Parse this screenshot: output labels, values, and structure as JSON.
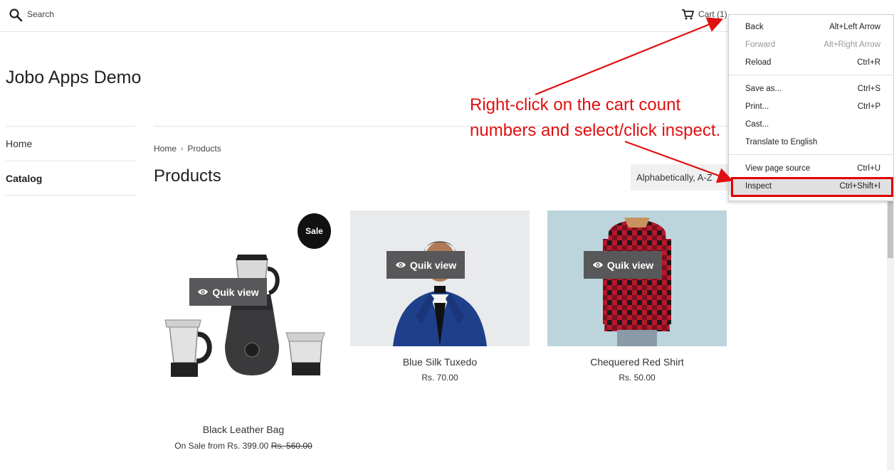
{
  "header": {
    "search_placeholder": "Search",
    "cart_label": "Cart (1)",
    "icons": {
      "search": "search-icon",
      "cart": "cart-icon"
    }
  },
  "site": {
    "title": "Jobo Apps Demo"
  },
  "sidebar": {
    "items": [
      {
        "label": "Home"
      },
      {
        "label": "Catalog"
      }
    ]
  },
  "breadcrumb": {
    "home": "Home",
    "separator": "›",
    "current": "Products"
  },
  "page": {
    "title": "Products",
    "sort_label": "Alphabetically, A-Z"
  },
  "products": [
    {
      "name": "Black Leather Bag",
      "price_prefix": "On Sale from Rs. 399.00",
      "compare_price": "Rs. 560.00",
      "badge": "Sale",
      "quick_view": "Quik view"
    },
    {
      "name": "Blue Silk Tuxedo",
      "price": "Rs. 70.00",
      "quick_view": "Quik view"
    },
    {
      "name": "Chequered Red Shirt",
      "price": "Rs. 50.00",
      "quick_view": "Quik view"
    }
  ],
  "context_menu": {
    "items": [
      {
        "label": "Back",
        "shortcut": "Alt+Left Arrow"
      },
      {
        "label": "Forward",
        "shortcut": "Alt+Right Arrow",
        "disabled": true
      },
      {
        "label": "Reload",
        "shortcut": "Ctrl+R"
      },
      {
        "label": "Save as...",
        "shortcut": "Ctrl+S"
      },
      {
        "label": "Print...",
        "shortcut": "Ctrl+P"
      },
      {
        "label": "Cast...",
        "shortcut": ""
      },
      {
        "label": "Translate to English",
        "shortcut": ""
      },
      {
        "label": "View page source",
        "shortcut": "Ctrl+U"
      },
      {
        "label": "Inspect",
        "shortcut": "Ctrl+Shift+I",
        "highlighted": true
      }
    ]
  },
  "annotation": {
    "line1": "Right-click on the cart count",
    "line2": "numbers and select/click inspect.",
    "color": "#e01010"
  }
}
